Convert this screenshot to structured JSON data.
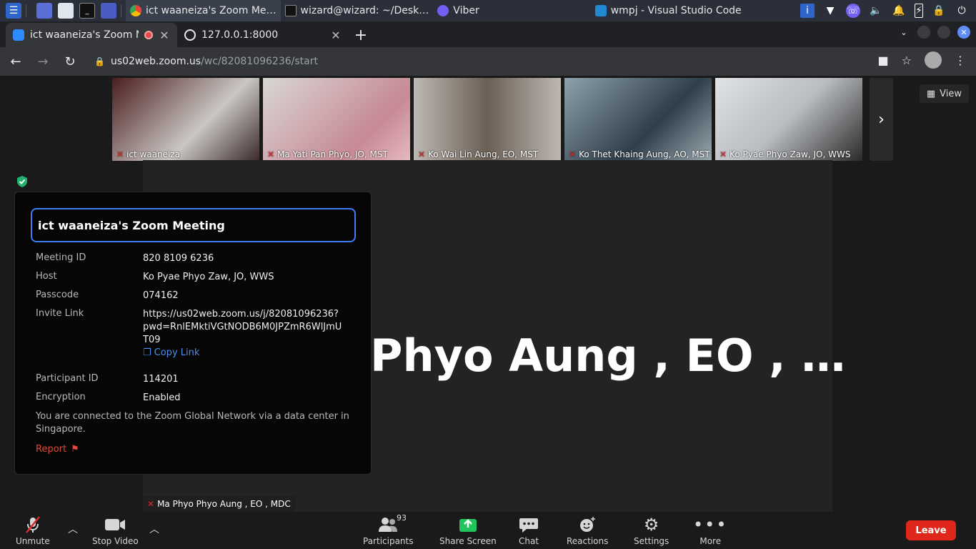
{
  "os": {
    "tasks": [
      {
        "label": "ict waaneiza's Zoom Me…"
      },
      {
        "label": "wizard@wizard: ~/Desk…"
      },
      {
        "label": "Viber"
      },
      {
        "label": "wmpj - Visual Studio Code"
      }
    ]
  },
  "browser": {
    "tabs": [
      {
        "title": "ict waaneiza's Zoom M",
        "active": true
      },
      {
        "title": "127.0.0.1:8000",
        "active": false
      }
    ],
    "new_tab": "+",
    "url_host": "us02web.zoom.us",
    "url_path": "/wc/82081096236/start"
  },
  "zoom": {
    "view_label": "View",
    "thumbnails": [
      {
        "name": "ict waaneiza",
        "bg": "#6a3030"
      },
      {
        "name": "Ma Yati Pan Phyo, JO, MST",
        "bg": "#c9a7a8"
      },
      {
        "name": "Ko Wai Lin Aung, EO, MST",
        "bg": "#8a8582"
      },
      {
        "name": "Ko Thet Khaing Aung, AO, MST",
        "bg": "#5c6a73"
      },
      {
        "name": "Ko Pyae Phyo Zaw, JO, WWS",
        "bg": "#bfc2c6"
      }
    ],
    "active_speaker_big": "Phyo Aung , EO , …",
    "active_speaker_label": "Ma Phyo Phyo Aung , EO , MDC"
  },
  "meeting_info": {
    "title": "ict waaneiza's Zoom Meeting",
    "meeting_id_label": "Meeting ID",
    "meeting_id": "820 8109 6236",
    "host_label": "Host",
    "host": "Ko Pyae Phyo Zaw, JO, WWS",
    "passcode_label": "Passcode",
    "passcode": "074162",
    "invite_label": "Invite Link",
    "invite_link": "https://us02web.zoom.us/j/82081096236?pwd=RnlEMktiVGtNODB6M0JPZmR6WlJmUT09",
    "copy_link": "Copy Link",
    "participant_id_label": "Participant ID",
    "participant_id": "114201",
    "encryption_label": "Encryption",
    "encryption": "Enabled",
    "network_text": "You are connected to the Zoom Global Network via a data center in Singapore.",
    "report": "Report"
  },
  "toolbar": {
    "unmute": "Unmute",
    "stop_video": "Stop Video",
    "participants": "Participants",
    "participants_count": "93",
    "share_screen": "Share Screen",
    "chat": "Chat",
    "reactions": "Reactions",
    "settings": "Settings",
    "more": "More",
    "leave": "Leave"
  },
  "colors": {
    "accent": "#3d7ef7",
    "leave": "#e0271b",
    "share": "#22c45e"
  }
}
